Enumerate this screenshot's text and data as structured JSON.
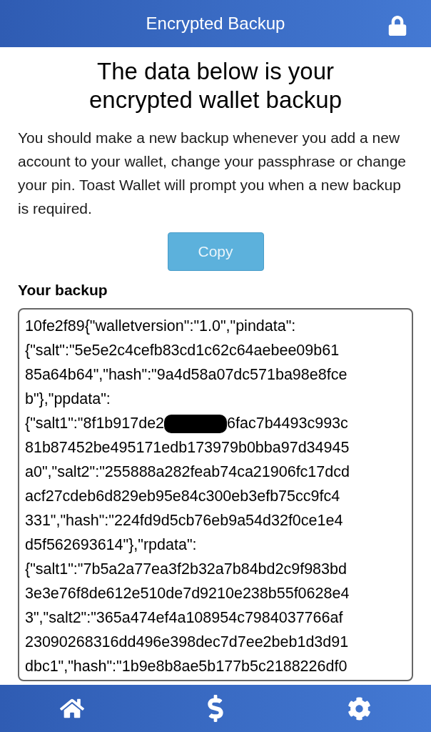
{
  "header": {
    "title": "Encrypted Backup"
  },
  "heading": "The data below is your encrypted wallet backup",
  "description": "You should make a new backup whenever you add a new account to your wallet, change your passphrase or change your pin. Toast Wallet will prompt you when a new backup is required.",
  "copy_button": "Copy",
  "backup": {
    "label": "Your backup",
    "lines": [
      {
        "segments": [
          "10fe2f89{\"walletversion\":\"1.0\",\"pindata\":"
        ],
        "redacted": false
      },
      {
        "segments": [
          "{\"salt\":\"5e5e2c4cefb83cd1c62c64aebee09b61"
        ],
        "redacted": false
      },
      {
        "segments": [
          "85a64b64\",\"hash\":\"9a4d58a07dc571ba98e8fce"
        ],
        "redacted": false
      },
      {
        "segments": [
          "b\"},\"ppdata\":"
        ],
        "redacted": false
      },
      {
        "segments": [
          "{\"salt1\":\"8f1b917de2",
          "6fac7b4493c993c"
        ],
        "redacted": true
      },
      {
        "segments": [
          "81b87452be495171edb173979b0bba97d34945"
        ],
        "redacted": false
      },
      {
        "segments": [
          "a0\",\"salt2\":\"255888a282feab74ca21906fc17dcd"
        ],
        "redacted": false
      },
      {
        "segments": [
          "acf27cdeb6d829eb95e84c300eb3efb75cc9fc4"
        ],
        "redacted": false
      },
      {
        "segments": [
          "331\",\"hash\":\"224fd9d5cb76eb9a54d32f0ce1e4"
        ],
        "redacted": false
      },
      {
        "segments": [
          "d5f562693614\"},\"rpdata\":"
        ],
        "redacted": false
      },
      {
        "segments": [
          "{\"salt1\":\"7b5a2a77ea3f2b32a7b84bd2c9f983bd"
        ],
        "redacted": false
      },
      {
        "segments": [
          "3e3e76f8de612e510de7d9210e238b55f0628e4"
        ],
        "redacted": false
      },
      {
        "segments": [
          "3\",\"salt2\":\"365a474ef4a108954c7984037766af"
        ],
        "redacted": false
      },
      {
        "segments": [
          "23090268316dd496e398dec7d7ee2beb1d3d91"
        ],
        "redacted": false
      },
      {
        "segments": [
          "dbc1\",\"hash\":\"1b9e8b8ae5b177b5c2188226df0"
        ],
        "redacted": false
      }
    ]
  },
  "tab_bar": [
    {
      "kind": "home"
    },
    {
      "kind": "dollar"
    },
    {
      "kind": "settings"
    }
  ]
}
